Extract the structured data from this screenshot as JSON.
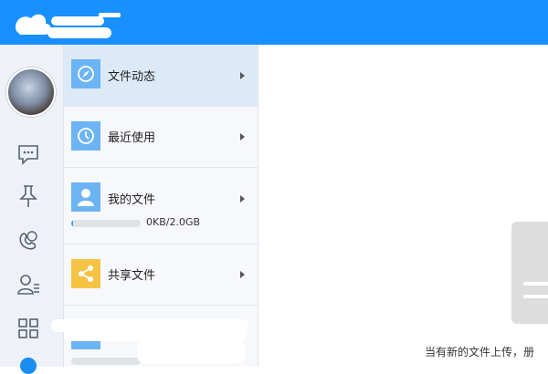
{
  "header": {
    "brand_color": "#1890ff",
    "logo_icon": "cloud-logo-icon"
  },
  "rail": {
    "icons": [
      "chat-icon",
      "pin-icon",
      "contacts-icon",
      "add-contact-icon",
      "apps-grid-icon"
    ]
  },
  "file_menu": {
    "items": [
      {
        "label": "文件动态",
        "icon": "compass-icon",
        "icon_color": "#6cb4f4",
        "active": true
      },
      {
        "label": "最近使用",
        "icon": "clock-icon",
        "icon_color": "#6cb4f4",
        "active": false
      },
      {
        "label": "我的文件",
        "icon": "person-icon",
        "icon_color": "#6cb4f4",
        "active": false
      },
      {
        "label": "共享文件",
        "icon": "share-icon",
        "icon_color": "#f5c344",
        "active": false
      }
    ],
    "storage": {
      "text": "0KB/2.0GB",
      "used_fraction": 0.01
    }
  },
  "main": {
    "hint": "当有新的文件上传，册"
  }
}
